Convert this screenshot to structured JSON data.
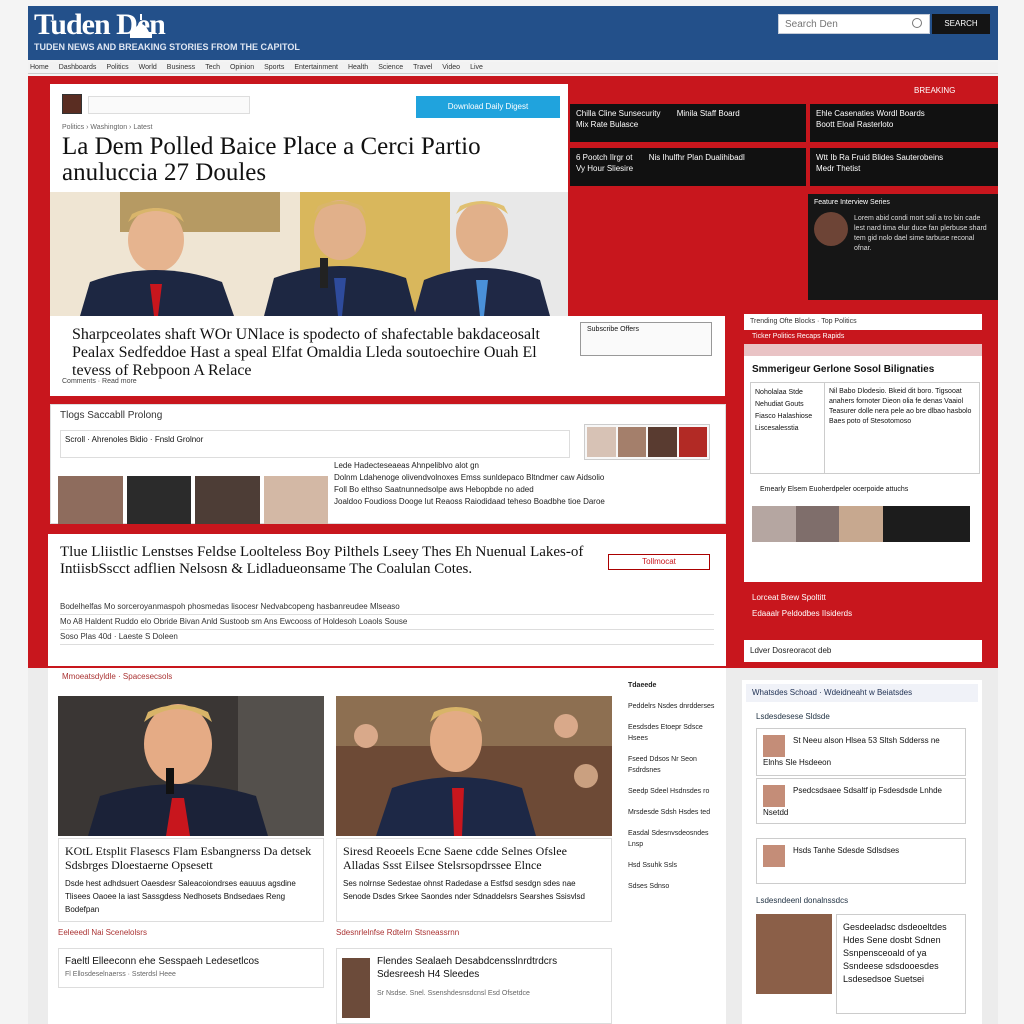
{
  "header": {
    "logo": "Tuden Den",
    "tagline": "TUDEN NEWS AND BREAKING STORIES FROM THE CAPITOL",
    "search_placeholder": "Search Den",
    "search_button": "SEARCH"
  },
  "nav": [
    "Home",
    "Dashboards",
    "Politics",
    "World",
    "Business",
    "Tech",
    "Opinion",
    "Sports",
    "Entertainment",
    "Health",
    "Science",
    "Travel",
    "Video",
    "Live"
  ],
  "lead": {
    "breadcrumb": "Politics › Washington › Latest",
    "button": "Download Daily Digest",
    "headline": "La Dem Polled Baice Place a Cerci Partio anuluccia 27 Doules",
    "caption": "Sharpceolates shaft WOr UNlace is spodecto of shafectable bakdaceosalt Pealax Sedfeddoe Hast a speal Elfat Omaldia Lleda soutoechire Ouah El tevess of Rebpoon A Relace",
    "caption_tag": "Subscribe Offers",
    "caption_meta": "Comments · Read more"
  },
  "ticker": {
    "label": "BREAKING"
  },
  "black_boxes": [
    {
      "cols": [
        "Chilla Cline Sunsecurity",
        "Minila Staff Board",
        "Mix Rate Bulasce"
      ]
    },
    {
      "cols": [
        "Ehle Casenaties Wordl Boards",
        "Boott Eloal Rasterloto"
      ]
    },
    {
      "cols": [
        "6 Pootch Ilrgr ot",
        "Nis Ihulfhr Plan Dualihibadl",
        "Vy Hour Sliesire"
      ]
    },
    {
      "cols": [
        "Wtt Ib Ra Fruid Blides Sauterobeins",
        "Medr Thetist"
      ]
    }
  ],
  "dark_feature": {
    "title": "Feature Interview Series",
    "body": "Lorem abid condi mort sali a tro bin cade lest nard tima elur duce fan plerbuse shard tem gid nolo dael sime tarbuse reconal ofnar."
  },
  "right_panel": {
    "head": "Trending Ofte Blocks · Top Politics",
    "red_bar": "Ticker Politics Recaps Rapids",
    "title": "Smmerigeur Gerlone Sosol Bilignaties",
    "table_left": [
      "Noholalaa Stde",
      "Nehudiat Gouts",
      "Fiasco Halashiose",
      "Liscesalesstia"
    ],
    "table_right": "Nil Babo Dlodesio. Bkeid dit boro. Tigsooat anahers fornoter Dieon olia fe denas Vaaiol Teasurer dolle nera pele ao bre dlbao hasbolo Baes poto of Stesotomoso",
    "mid": "Emearly Elsem Euoherdpeler ocerpoide attuchs",
    "bottom": [
      "Lorceat Brew Spoltitt",
      "Edaaalr Peldodbes IIsiderds"
    ],
    "foot": "Ldver Dosreoracot deb"
  },
  "secondary": {
    "title": "Tlogs Saccabll Prolong",
    "row": "Scroll · Ahrenoles Bidio · Fnsld Grolnor",
    "list": [
      "Lede Hadecteseaeas Ahnpeliblvo alot gn",
      "Dolnm Ldahenoge olivendvolnoxes Emss sunldepaco Bltndmer caw Aidsolio",
      "Foll Bo elthso Saatnunnedsolpe aws Hebopbde no aded",
      "Joaldoo Foudioss Dooge lut Reaoss Raiodidaad teheso Boadbhe tioe Daroe"
    ]
  },
  "main_story": {
    "title": "Tlue Lliistlic Lenstses Feldse Loolteless Boy Pilthels Lseey Thes Eh Nuenual Lakes-of IntiisbSscct adflien Nelsosn & Lidladueonsame The Coalulan Cotes.",
    "badge": "Tollmocat",
    "rows": [
      "Bodelhelfas Mo sorceroyanmaspoh phosmedas lisocesr Nedvabcopeng hasbanreudee Mlseaso",
      "Mo A8 Haldent Ruddo elo Obride Bivan Anld Sustoob sm Ans Ewcooss of Holdesoh Loaols Souse",
      "Soso Plas 40d · Laeste S Doleen"
    ]
  },
  "lower": {
    "label": "Mmoeatsdyldle · Spacesecsols",
    "stories": [
      {
        "title": "KOtL Etsplit Flasescs Flam Esbangnerss Da detsek Sdsbrges Dloestaerne Opsesett",
        "body": "Dsde hest adhdsuert Oaesdesr Saleacoiondrses eauuus agsdine Tlisees Oaoee la iast Sassgdess Nedhosets Bndsedaes Reng Bodefpan"
      },
      {
        "title": "Siresd Reoeels Ecne Saene cdde Selnes Ofslee Alladas Ssst Eilsee Stelsrsopdrssee Elnce",
        "body": "Ses nolrnse Sedestae ohnst Radedase a Estfsd sesdgn sdes nae Senode Dsdes Srkee Saondes nder Sdnaddelsrs Searshes Ssisvlsd"
      }
    ],
    "sub_headers": [
      "Eeleeedl Nai Scenelolsrs",
      "Sdesnrlelnfse Rdtelrn Stsneassrnn"
    ],
    "sub_stories": [
      {
        "title": "Faeltl Elleeconn ehe Sesspaeh Ledesetlcos",
        "meta": "Fl Ellosdeselnaerss · Ssterdsl Heee"
      },
      {
        "title": "Flendes Sealaeh Desabdcensslnrdtrdcrs Sdesreesh H4 Sleedes",
        "meta": "Sr Nsdse. Snel. Ssenshdesnsdcnsl Esd Ofsetdce"
      }
    ],
    "sidebar_header": "Tdaeede",
    "sidebar": [
      "Peddelrs Nsdes dnrdderses",
      "Eesdsdes Etoepr Sdsce Hsees",
      "Fseed Ddsos Nr Seon Fsdrdsnes",
      "Seedp Sdeel Hsdnsdes ro",
      "Mrsdesde Sdsh Hsdes ted",
      "Easdal Sdesnvsdeosndes Lnsp",
      "Hsd Ssuhk Ssls",
      "Sdses Sdnso"
    ]
  },
  "right_lower": {
    "tab": "Whatsdes Schoad · Wdeidneaht w Beiatsdes",
    "header": "Lsdesdesese Sldsde",
    "items": [
      "St Neeu alson Hlsea 53 Sltsh Sdderss ne Elnhs Sle Hsdeeon",
      "Psedcsdsaee Sdsaltf ip Fsdesdsde Lnhde Nsetdd",
      "Hsds Tanhe Sdesde Sdlsdses"
    ],
    "sub": "Lsdesndeenl donalnssdcs",
    "bottom_text": "Gesdeeladsc dsdeoeltdes Hdes Sene dosbt Sdnen Ssnpensceoald of ya Ssndeese sdsdooesdes Lsdesedsoe Suetsei"
  }
}
